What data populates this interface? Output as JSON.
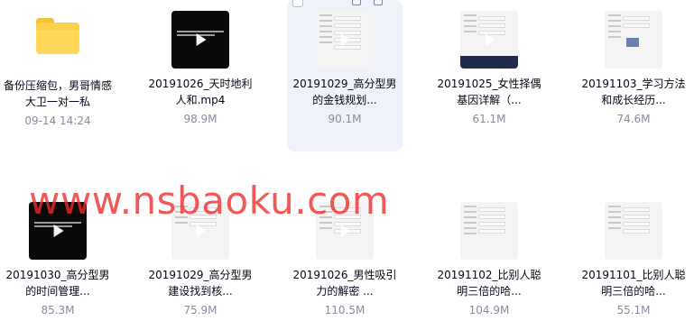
{
  "files": [
    {
      "kind": "folder",
      "name": "备份压缩包，男哥情感 大卫一对一私",
      "meta": "09-14 14:24"
    },
    {
      "kind": "video-dark",
      "name": "20191026_天时地利人和.mp4",
      "meta": "98.9M"
    },
    {
      "kind": "video-doc",
      "name": "20191029_高分型男的金钱规划...",
      "meta": "90.1M",
      "selected": true
    },
    {
      "kind": "video-doc-navy",
      "name": "20191025_女性择偶基因详解（...",
      "meta": "61.1M"
    },
    {
      "kind": "video-doc-pic",
      "name": "20191103_学习方法和成长经历...",
      "meta": "74.6M"
    },
    {
      "kind": "video-dark",
      "name": "20191030_高分型男的时间管理...",
      "meta": "85.3M"
    },
    {
      "kind": "video-doc",
      "name": "20191029_高分型男建设找到核...",
      "meta": "75.9M"
    },
    {
      "kind": "video-doc",
      "name": "20191026_男性吸引力的解密 ...",
      "meta": "110.5M"
    },
    {
      "kind": "video-doc",
      "name": "20191102_比别人聪明三倍的哈...",
      "meta": "104.9M"
    },
    {
      "kind": "video-doc",
      "name": "20191101_比别人聪明三倍的哈...",
      "meta": "55.1M"
    }
  ],
  "watermark": "www.nsbaoku.com",
  "icons": {
    "folder": "folder-icon",
    "video": "video-thumbnail",
    "play": "play-icon"
  },
  "colors": {
    "name": "#03081a",
    "meta": "#878c9c",
    "selected_bg": "#eff2f8",
    "watermark": "#ee2b2b",
    "folder": "#fbd24a"
  }
}
